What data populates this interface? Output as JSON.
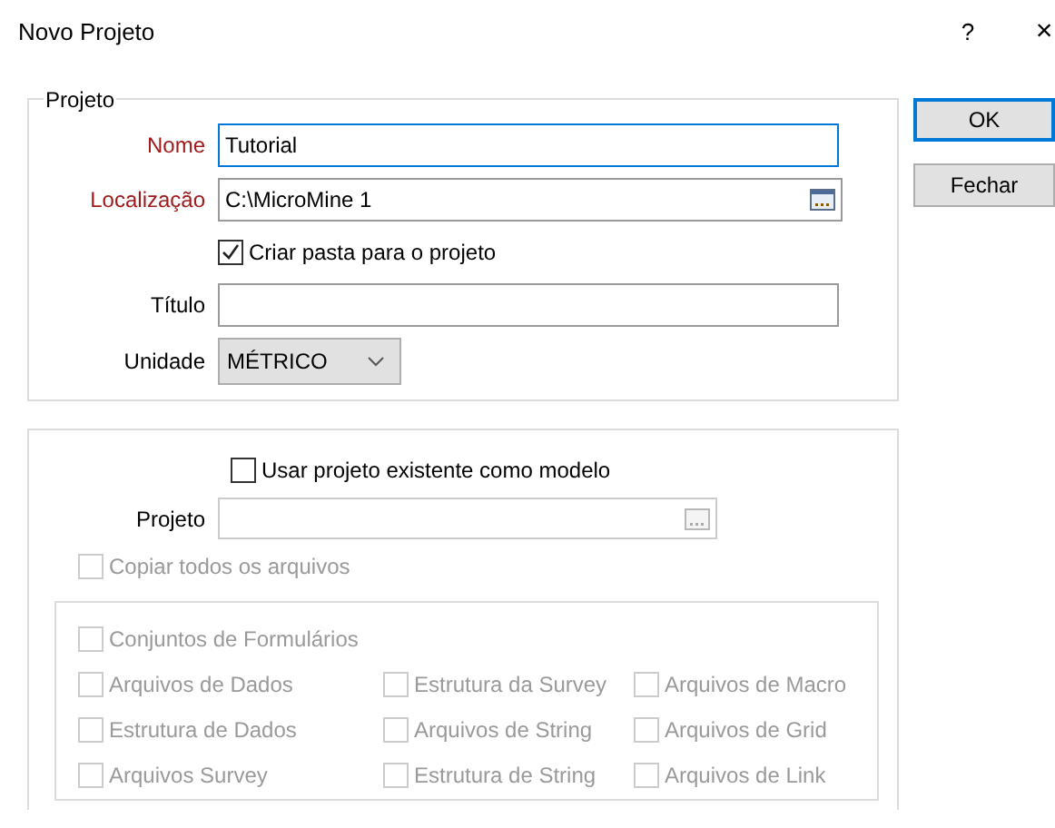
{
  "window": {
    "title": "Novo Projeto",
    "help": "?",
    "close": "×"
  },
  "projeto_group": {
    "legend": "Projeto",
    "rows": [
      {
        "kind": "text",
        "label": "Nome",
        "required": true,
        "value": "Tutorial",
        "focused": true
      },
      {
        "kind": "browse",
        "label": "Localização",
        "required": true,
        "value": "C:\\MicroMine 1",
        "focused": false
      },
      {
        "kind": "checkbox",
        "label": "Criar pasta para o projeto",
        "checked": true
      },
      {
        "kind": "text",
        "label": "Título",
        "required": false,
        "value": "",
        "focused": false
      },
      {
        "kind": "dropdown",
        "label": "Unidade",
        "required": false,
        "value": "MÉTRICO"
      }
    ]
  },
  "buttons": [
    {
      "label": "OK",
      "default": true
    },
    {
      "label": "Fechar",
      "default": false
    }
  ],
  "template_group": {
    "use_template": {
      "label": "Usar projeto existente como modelo",
      "checked": false
    },
    "projeto_field": {
      "label": "Projeto",
      "disabled": true
    },
    "copy_all": {
      "label": "Copiar todos os arquivos",
      "checked": false,
      "disabled": true
    },
    "file_types": [
      {
        "label": "Conjuntos de Formulários",
        "checked": false,
        "disabled": true
      },
      {
        "label": "Arquivos de Dados",
        "checked": false,
        "disabled": true
      },
      {
        "label": "Estrutura da Survey",
        "checked": false,
        "disabled": true
      },
      {
        "label": "Arquivos de Macro",
        "checked": false,
        "disabled": true
      },
      {
        "label": "Estrutura de Dados",
        "checked": false,
        "disabled": true
      },
      {
        "label": "Arquivos de String",
        "checked": false,
        "disabled": true
      },
      {
        "label": "Arquivos de Grid",
        "checked": false,
        "disabled": true
      },
      {
        "label": "Arquivos Survey",
        "checked": false,
        "disabled": true
      },
      {
        "label": "Estrutura de String",
        "checked": false,
        "disabled": true
      },
      {
        "label": "Arquivos de Link",
        "checked": false,
        "disabled": true
      }
    ]
  }
}
